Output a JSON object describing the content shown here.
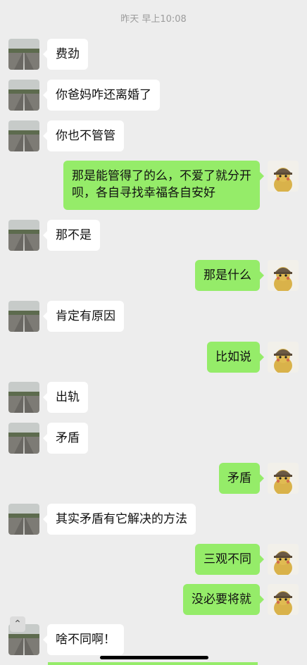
{
  "timestamp": "昨天 早上10:08",
  "messages": [
    {
      "dir": "in",
      "text": "费劲"
    },
    {
      "dir": "in",
      "text": "你爸妈咋还离婚了"
    },
    {
      "dir": "in",
      "text": "你也不管管"
    },
    {
      "dir": "out",
      "text": "那是能管得了的么，不爱了就分开\n呗，各自寻找幸福各自安好"
    },
    {
      "dir": "in",
      "text": "那不是"
    },
    {
      "dir": "out",
      "text": "那是什么"
    },
    {
      "dir": "in",
      "text": "肯定有原因"
    },
    {
      "dir": "out",
      "text": "比如说"
    },
    {
      "dir": "in",
      "text": "出轨"
    },
    {
      "dir": "in",
      "text": "矛盾"
    },
    {
      "dir": "out",
      "text": "矛盾"
    },
    {
      "dir": "in",
      "text": "其实矛盾有它解决的方法"
    },
    {
      "dir": "out",
      "text": "三观不同"
    },
    {
      "dir": "out",
      "text": "没必要将就"
    },
    {
      "dir": "in",
      "text": "啥不同啊！"
    }
  ],
  "icons": {
    "road_avatar": "road-avatar-icon",
    "pikachu_avatar": "pikachu-avatar-icon",
    "scroll_up": "chevron-up-icon"
  },
  "colors": {
    "background": "#ededed",
    "incoming_bubble": "#ffffff",
    "outgoing_bubble": "#95ec69"
  }
}
